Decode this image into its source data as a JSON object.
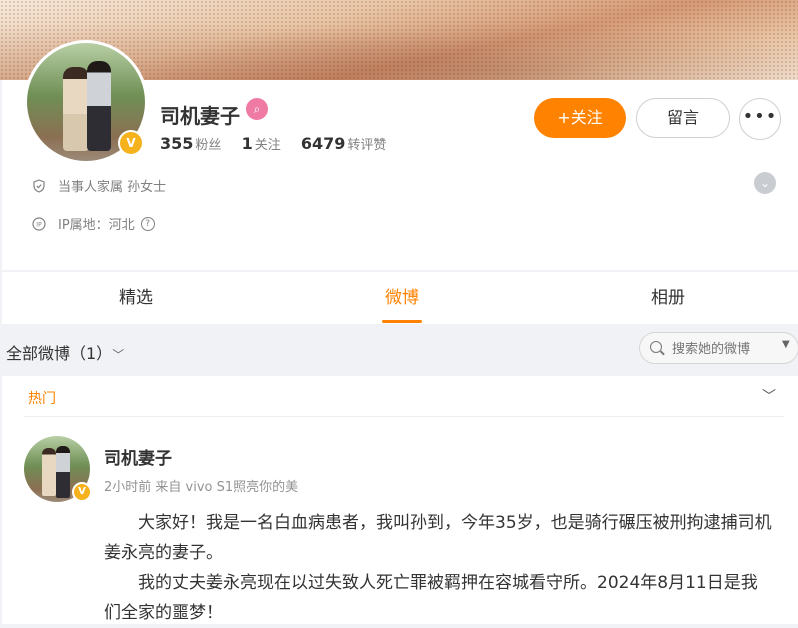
{
  "profile": {
    "username": "司机妻子",
    "stats": [
      {
        "value": "355",
        "label": "粉丝"
      },
      {
        "value": "1",
        "label": "关注"
      },
      {
        "value": "6479",
        "label": "转评赞"
      }
    ],
    "follow_label": "+关注",
    "message_label": "留言",
    "more_label": "•••",
    "info_relation": "当事人家属 孙女士",
    "info_ip": "IP属地：河北"
  },
  "tabs": [
    {
      "label": "精选",
      "active": false
    },
    {
      "label": "微博",
      "active": true
    },
    {
      "label": "相册",
      "active": false
    }
  ],
  "filter": {
    "label": "全部微博（1）",
    "search_placeholder": "搜索她的微博"
  },
  "feed": {
    "section_label": "热门",
    "post": {
      "author": "司机妻子",
      "meta": "2小时前  来自 vivo S1照亮你的美",
      "paragraphs": [
        "大家好！我是一名白血病患者，我叫孙到，今年35岁，也是骑行碾压被刑拘逮捕司机姜永亮的妻子。",
        "我的丈夫姜永亮现在以过失致人死亡罪被羁押在容城看守所。2024年8月11日是我们全家的噩梦！"
      ]
    }
  },
  "colors": {
    "accent": "#ff8200",
    "verified_badge": "#f6b21c",
    "tag_pink": "#ef7ba4",
    "page_bg": "#f1f2f5"
  }
}
